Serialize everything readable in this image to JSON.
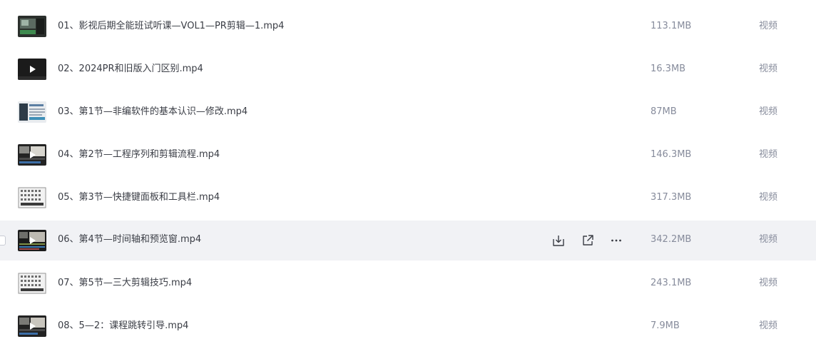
{
  "files": [
    {
      "name": "01、影视后期全能班试听课—VOL1—PR剪辑—1.mp4",
      "size": "113.1MB",
      "type": "视频",
      "thumb": "screen-dark"
    },
    {
      "name": "02、2024PR和旧版入门区别.mp4",
      "size": "16.3MB",
      "type": "视频",
      "thumb": "black-play"
    },
    {
      "name": "03、第1节—非编软件的基本认识—修改.mp4",
      "size": "87MB",
      "type": "视频",
      "thumb": "slide-light"
    },
    {
      "name": "04、第2节—工程序列和剪辑流程.mp4",
      "size": "146.3MB",
      "type": "视频",
      "thumb": "dark-editor"
    },
    {
      "name": "05、第3节—快捷键面板和工具栏.mp4",
      "size": "317.3MB",
      "type": "视频",
      "thumb": "keyboard-grid"
    },
    {
      "name": "06、第4节—时间轴和预览窗.mp4",
      "size": "342.2MB",
      "type": "视频",
      "thumb": "dark-timeline",
      "hovered": true
    },
    {
      "name": "07、第5节—三大剪辑技巧.mp4",
      "size": "243.1MB",
      "type": "视频",
      "thumb": "keyboard-grid"
    },
    {
      "name": "08、5—2：课程跳转引导.mp4",
      "size": "7.9MB",
      "type": "视频",
      "thumb": "dark-editor"
    }
  ],
  "actions": {
    "download_icon": "download-icon",
    "share_icon": "share-icon",
    "more_icon": "more-icon"
  },
  "colors": {
    "hover_bg": "#f1f2f5",
    "name_text": "#3a3d45",
    "meta_text": "#878c9c"
  }
}
